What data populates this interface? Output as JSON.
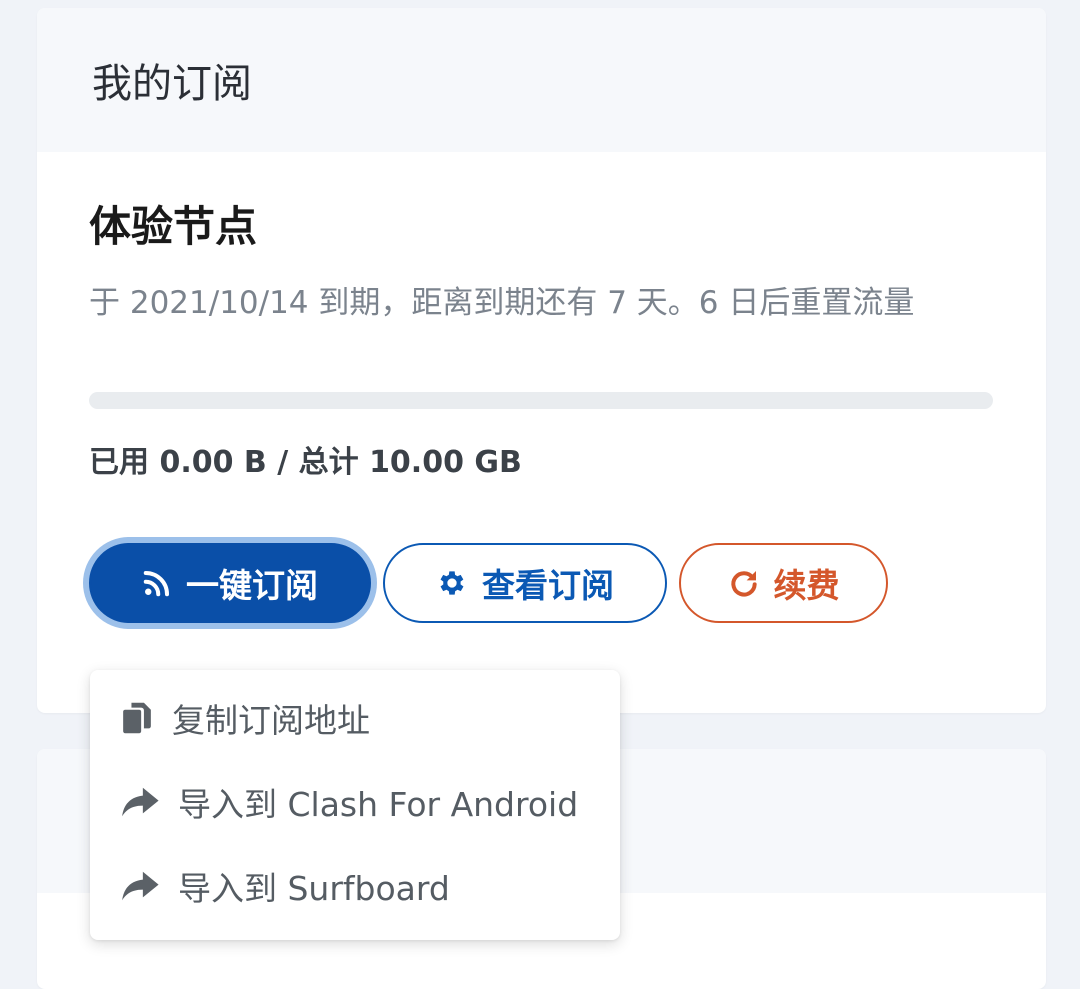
{
  "subscription_card": {
    "title": "我的订阅",
    "plan_name": "体验节点",
    "description": "于 2021/10/14 到期，距离到期还有 7 天。6 日后重置流量",
    "usage_progress_percent": 0,
    "usage_text": "已用 0.00 B / 总计 10.00 GB",
    "buttons": {
      "one_click": {
        "label": "一键订阅",
        "icon": "rss-icon"
      },
      "view": {
        "label": "查看订阅",
        "icon": "gear-icon"
      },
      "renew": {
        "label": "续费",
        "icon": "redo-icon"
      }
    }
  },
  "dropdown": {
    "items": [
      {
        "label": "复制订阅地址",
        "icon": "copy-icon"
      },
      {
        "label": "导入到 Clash For Android",
        "icon": "share-icon"
      },
      {
        "label": "导入到 Surfboard",
        "icon": "share-icon"
      }
    ]
  },
  "colors": {
    "primary": "#0a4fa8",
    "outline_blue": "#0b59b4",
    "warning": "#d4572b",
    "muted_text": "#7b838d"
  }
}
